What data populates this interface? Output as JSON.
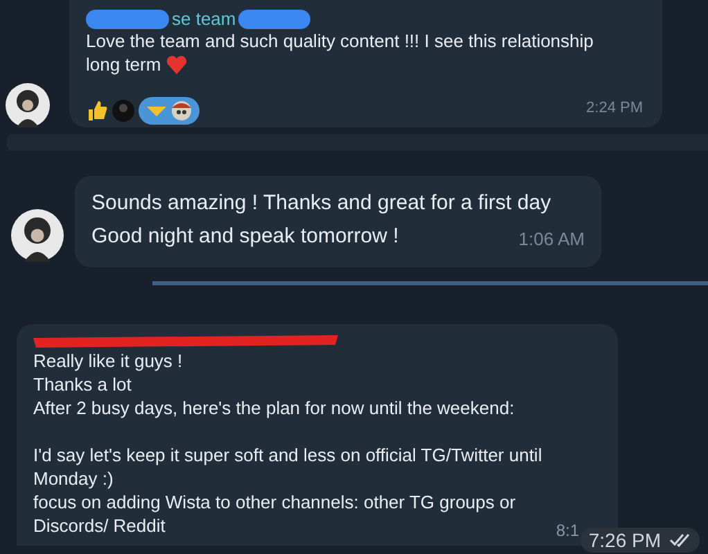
{
  "messages": [
    {
      "kind": "incoming",
      "sender": "se team",
      "sender_redacted": true,
      "paragraphs": [
        [
          "Love the team and such quality content !!! I see this relationship",
          "long term"
        ]
      ],
      "heart": true,
      "reactions": [
        {
          "kind": "thumbs",
          "selected": false
        },
        {
          "kind": "dark",
          "selected": false
        },
        {
          "kind": "pair",
          "selected": true
        }
      ],
      "time": "2:24 PM",
      "avatar": true
    },
    {
      "kind": "incoming",
      "paragraphs": [
        [
          "Sounds amazing ! Thanks and great for a first day",
          "Good night and speak tomorrow !"
        ]
      ],
      "time": "1:06 AM",
      "avatar": true
    },
    {
      "kind": "incoming",
      "sender_redacted": true,
      "paragraphs": [
        [
          "Really like it guys !",
          "Thanks a lot",
          "After 2 busy days, here's the plan for now until the weekend:"
        ],
        [
          "I'd say let's keep it super soft and less on official TG/Twitter until",
          "Monday :)",
          "focus on adding Wista to other channels: other TG groups or",
          "Discords/ Reddit"
        ]
      ],
      "time": "8:1",
      "overlay_time": "7:26 PM"
    }
  ]
}
